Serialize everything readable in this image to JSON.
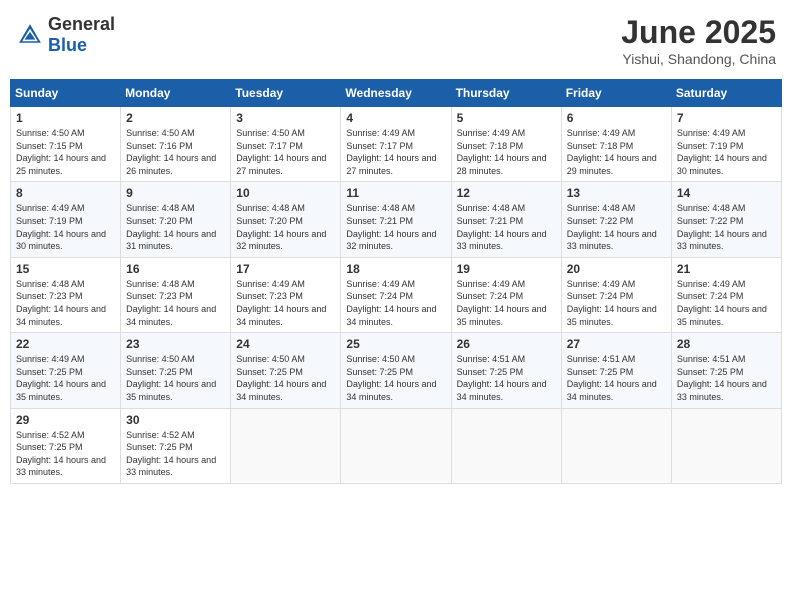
{
  "header": {
    "logo_general": "General",
    "logo_blue": "Blue",
    "month_title": "June 2025",
    "subtitle": "Yishui, Shandong, China"
  },
  "days_of_week": [
    "Sunday",
    "Monday",
    "Tuesday",
    "Wednesday",
    "Thursday",
    "Friday",
    "Saturday"
  ],
  "weeks": [
    [
      {
        "day": "1",
        "sunrise": "4:50 AM",
        "sunset": "7:15 PM",
        "daylight": "14 hours and 25 minutes."
      },
      {
        "day": "2",
        "sunrise": "4:50 AM",
        "sunset": "7:16 PM",
        "daylight": "14 hours and 26 minutes."
      },
      {
        "day": "3",
        "sunrise": "4:50 AM",
        "sunset": "7:17 PM",
        "daylight": "14 hours and 27 minutes."
      },
      {
        "day": "4",
        "sunrise": "4:49 AM",
        "sunset": "7:17 PM",
        "daylight": "14 hours and 27 minutes."
      },
      {
        "day": "5",
        "sunrise": "4:49 AM",
        "sunset": "7:18 PM",
        "daylight": "14 hours and 28 minutes."
      },
      {
        "day": "6",
        "sunrise": "4:49 AM",
        "sunset": "7:18 PM",
        "daylight": "14 hours and 29 minutes."
      },
      {
        "day": "7",
        "sunrise": "4:49 AM",
        "sunset": "7:19 PM",
        "daylight": "14 hours and 30 minutes."
      }
    ],
    [
      {
        "day": "8",
        "sunrise": "4:49 AM",
        "sunset": "7:19 PM",
        "daylight": "14 hours and 30 minutes."
      },
      {
        "day": "9",
        "sunrise": "4:48 AM",
        "sunset": "7:20 PM",
        "daylight": "14 hours and 31 minutes."
      },
      {
        "day": "10",
        "sunrise": "4:48 AM",
        "sunset": "7:20 PM",
        "daylight": "14 hours and 32 minutes."
      },
      {
        "day": "11",
        "sunrise": "4:48 AM",
        "sunset": "7:21 PM",
        "daylight": "14 hours and 32 minutes."
      },
      {
        "day": "12",
        "sunrise": "4:48 AM",
        "sunset": "7:21 PM",
        "daylight": "14 hours and 33 minutes."
      },
      {
        "day": "13",
        "sunrise": "4:48 AM",
        "sunset": "7:22 PM",
        "daylight": "14 hours and 33 minutes."
      },
      {
        "day": "14",
        "sunrise": "4:48 AM",
        "sunset": "7:22 PM",
        "daylight": "14 hours and 33 minutes."
      }
    ],
    [
      {
        "day": "15",
        "sunrise": "4:48 AM",
        "sunset": "7:23 PM",
        "daylight": "14 hours and 34 minutes."
      },
      {
        "day": "16",
        "sunrise": "4:48 AM",
        "sunset": "7:23 PM",
        "daylight": "14 hours and 34 minutes."
      },
      {
        "day": "17",
        "sunrise": "4:49 AM",
        "sunset": "7:23 PM",
        "daylight": "14 hours and 34 minutes."
      },
      {
        "day": "18",
        "sunrise": "4:49 AM",
        "sunset": "7:24 PM",
        "daylight": "14 hours and 34 minutes."
      },
      {
        "day": "19",
        "sunrise": "4:49 AM",
        "sunset": "7:24 PM",
        "daylight": "14 hours and 35 minutes."
      },
      {
        "day": "20",
        "sunrise": "4:49 AM",
        "sunset": "7:24 PM",
        "daylight": "14 hours and 35 minutes."
      },
      {
        "day": "21",
        "sunrise": "4:49 AM",
        "sunset": "7:24 PM",
        "daylight": "14 hours and 35 minutes."
      }
    ],
    [
      {
        "day": "22",
        "sunrise": "4:49 AM",
        "sunset": "7:25 PM",
        "daylight": "14 hours and 35 minutes."
      },
      {
        "day": "23",
        "sunrise": "4:50 AM",
        "sunset": "7:25 PM",
        "daylight": "14 hours and 35 minutes."
      },
      {
        "day": "24",
        "sunrise": "4:50 AM",
        "sunset": "7:25 PM",
        "daylight": "14 hours and 34 minutes."
      },
      {
        "day": "25",
        "sunrise": "4:50 AM",
        "sunset": "7:25 PM",
        "daylight": "14 hours and 34 minutes."
      },
      {
        "day": "26",
        "sunrise": "4:51 AM",
        "sunset": "7:25 PM",
        "daylight": "14 hours and 34 minutes."
      },
      {
        "day": "27",
        "sunrise": "4:51 AM",
        "sunset": "7:25 PM",
        "daylight": "14 hours and 34 minutes."
      },
      {
        "day": "28",
        "sunrise": "4:51 AM",
        "sunset": "7:25 PM",
        "daylight": "14 hours and 33 minutes."
      }
    ],
    [
      {
        "day": "29",
        "sunrise": "4:52 AM",
        "sunset": "7:25 PM",
        "daylight": "14 hours and 33 minutes."
      },
      {
        "day": "30",
        "sunrise": "4:52 AM",
        "sunset": "7:25 PM",
        "daylight": "14 hours and 33 minutes."
      },
      null,
      null,
      null,
      null,
      null
    ]
  ]
}
